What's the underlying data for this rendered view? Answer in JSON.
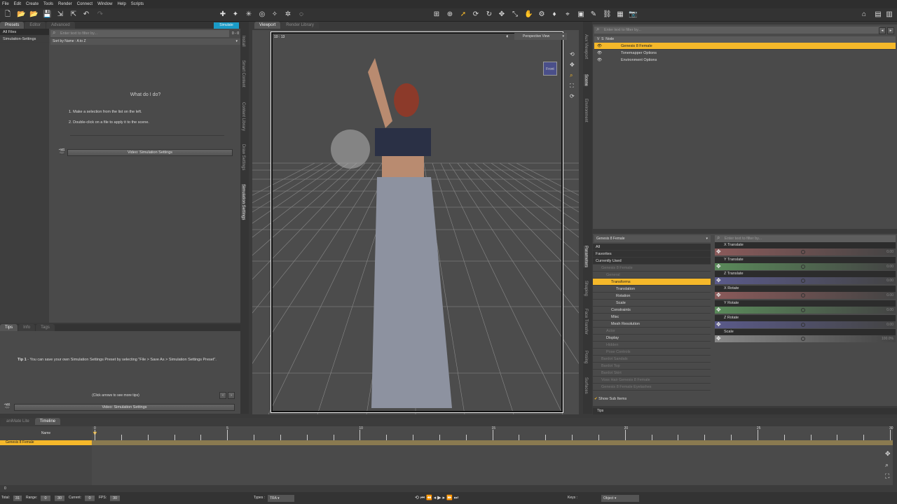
{
  "menu": [
    "File",
    "Edit",
    "Create",
    "Tools",
    "Render",
    "Connect",
    "Window",
    "Help",
    "Scripts"
  ],
  "left_panel": {
    "tabs": [
      "Presets",
      "Editor",
      "Advanced"
    ],
    "simulate_label": "Simulate",
    "categories": [
      "All Files",
      "Simulation-Settings"
    ],
    "filter_placeholder": "Enter text to filter by...",
    "count": "0 - 0",
    "sort": "Sort by Name : A to Z",
    "help_title": "What do I do?",
    "steps": [
      "1. Make a selection from the list on the left.",
      "2. Double-click on a file to apply it to the scene."
    ],
    "video_button": "Video: Simulation Settings",
    "side_tabs": [
      "Install",
      "Smart Content",
      "Content Library",
      "Draw Settings",
      "Simulation Settings"
    ]
  },
  "tips_panel": {
    "tabs": [
      "Tips",
      "Info",
      "Tags"
    ],
    "tip_label": "Tip 1",
    "tip_text": " - You can save your own Simulation Settings Preset by selecting \"File > Save As > Simulation Settings Preset\".",
    "more": "(Click arrows to see more tips)",
    "prev": "‹",
    "next": "›",
    "video_button": "Video: Simulation Settings"
  },
  "viewport": {
    "tabs": [
      "Viewport",
      "Render Library"
    ],
    "aspect": "10 : 13",
    "view": "Perspective View",
    "cube_label": "Front"
  },
  "right_tabs_top": [
    "Aux Viewport",
    "Scene",
    "Environment"
  ],
  "right_tabs_bottom": [
    "Parameters",
    "Shaping",
    "Face Transfer",
    "Posing",
    "Surfaces"
  ],
  "scene": {
    "filter_placeholder": "Enter text to filter by...",
    "header": "Node",
    "nodes": [
      "Genesis 8 Female",
      "Tonemapper Options",
      "Environment Options"
    ]
  },
  "parameters": {
    "node_select": "Genesis 8 Female",
    "filter_placeholder": "Enter text to filter by...",
    "tree": [
      {
        "label": "All",
        "indent": 0,
        "type": "plain"
      },
      {
        "label": "Favorites",
        "indent": 0,
        "type": "plain"
      },
      {
        "label": "Currently Used",
        "indent": 0,
        "type": "plain"
      },
      {
        "label": "Genesis 8 Female",
        "indent": 0,
        "type": "dim"
      },
      {
        "label": "General",
        "indent": 1,
        "type": "dim"
      },
      {
        "label": "Transforms",
        "indent": 2,
        "type": "sel"
      },
      {
        "label": "Translation",
        "indent": 3,
        "type": "item"
      },
      {
        "label": "Rotation",
        "indent": 3,
        "type": "item"
      },
      {
        "label": "Scale",
        "indent": 3,
        "type": "item"
      },
      {
        "label": "Constraints",
        "indent": 2,
        "type": "item"
      },
      {
        "label": "Misc",
        "indent": 2,
        "type": "item"
      },
      {
        "label": "Mesh Resolution",
        "indent": 2,
        "type": "item"
      },
      {
        "label": "Actor",
        "indent": 1,
        "type": "dim"
      },
      {
        "label": "Display",
        "indent": 1,
        "type": "item"
      },
      {
        "label": "Hidden",
        "indent": 1,
        "type": "dim"
      },
      {
        "label": "Pose Controls",
        "indent": 1,
        "type": "dim"
      },
      {
        "label": "Bardot Sandals",
        "indent": 0,
        "type": "dim"
      },
      {
        "label": "Bardot Top",
        "indent": 0,
        "type": "dim"
      },
      {
        "label": "Bardot Skirt",
        "indent": 0,
        "type": "dim"
      },
      {
        "label": "Voss Hair Genesis 8 Female",
        "indent": 0,
        "type": "dim"
      },
      {
        "label": "Genesis 8 Female Eyelashes",
        "indent": 0,
        "type": "dim"
      }
    ],
    "show_sub_items": "Show Sub Items",
    "sliders": [
      {
        "label": "X Translate",
        "value": "0.00",
        "color": "#8a5a5a"
      },
      {
        "label": "Y Translate",
        "value": "0.00",
        "color": "#5a8a5a"
      },
      {
        "label": "Z Translate",
        "value": "0.00",
        "color": "#5a5a8a"
      },
      {
        "label": "X Rotate",
        "value": "0.00",
        "color": "#8a5a5a"
      },
      {
        "label": "Y Rotate",
        "value": "0.00",
        "color": "#5a8a5a"
      },
      {
        "label": "Z Rotate",
        "value": "0.00",
        "color": "#5a5a8a"
      },
      {
        "label": "Scale",
        "value": "100.0%",
        "color": "#888888"
      }
    ],
    "tips_tab": "Tips"
  },
  "timeline": {
    "tabs": [
      "aniMate Lite",
      "Timeline"
    ],
    "name_header": "Name",
    "track": "Genesis 8 Female",
    "ticks": [
      "0",
      "5",
      "10",
      "15",
      "20",
      "25",
      "30"
    ],
    "total_label": "Total:",
    "total": "31",
    "range_label": "Range:",
    "range_start": "0",
    "range_end": "30",
    "current_label": "Current:",
    "current": "0",
    "fps_label": "FPS:",
    "fps": "30",
    "types_label": "Types :",
    "types": "TRA",
    "keys_label": "Keys :",
    "keys_mode": "Object",
    "frame_marker": "0"
  },
  "colors": {
    "accent": "#f5b82a",
    "simulate": "#1a9bc7"
  }
}
